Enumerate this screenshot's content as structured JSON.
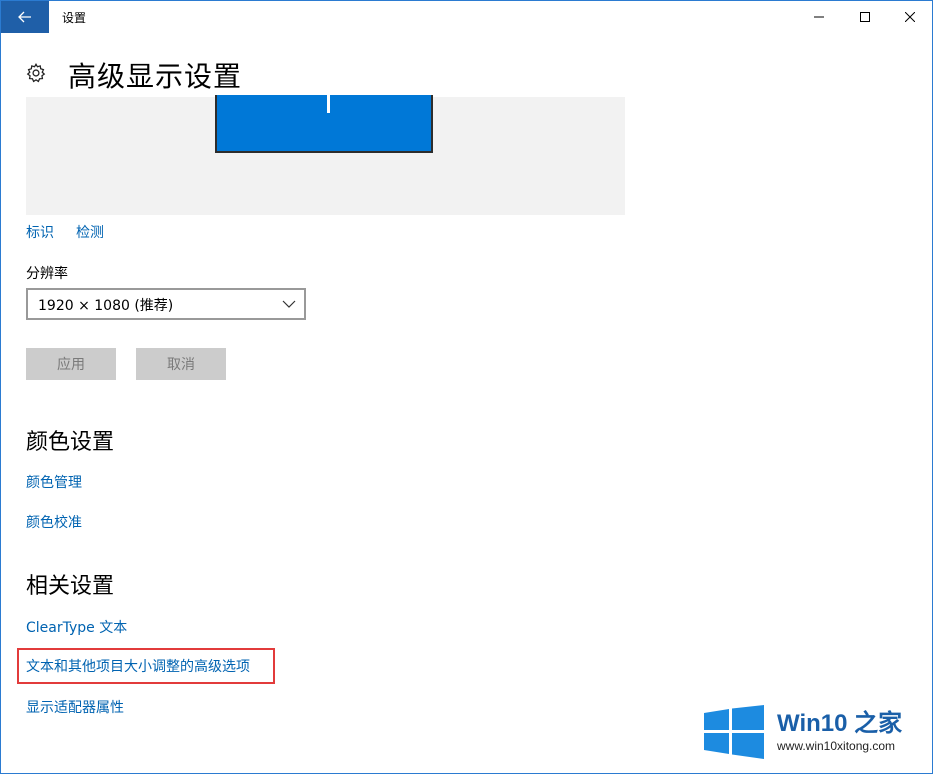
{
  "titlebar": {
    "title": "设置"
  },
  "header": {
    "title": "高级显示设置"
  },
  "display_preview": {
    "links": {
      "identify": "标识",
      "detect": "检测"
    }
  },
  "resolution": {
    "label": "分辨率",
    "selected": "1920 × 1080 (推荐)"
  },
  "buttons": {
    "apply": "应用",
    "cancel": "取消"
  },
  "color_settings": {
    "title": "颜色设置",
    "color_management": "颜色管理",
    "color_calibration": "颜色校准"
  },
  "related_settings": {
    "title": "相关设置",
    "cleartype": "ClearType 文本",
    "advanced_sizing": "文本和其他项目大小调整的高级选项",
    "adapter_properties": "显示适配器属性"
  },
  "watermark": {
    "brand": "Win10 之家",
    "url": "www.win10xitong.com"
  },
  "colors": {
    "accent": "#0078d7",
    "link": "#0063b1",
    "highlight_box": "#e23b3b"
  }
}
